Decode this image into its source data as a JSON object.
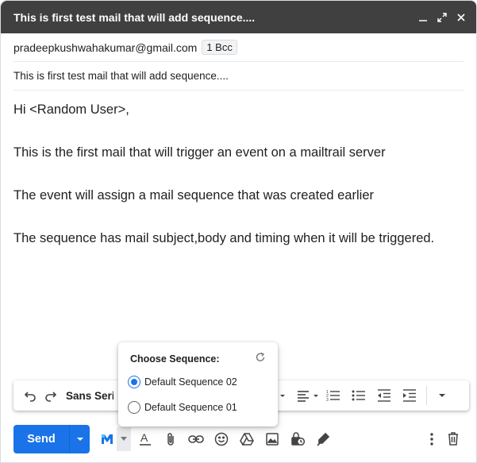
{
  "window": {
    "title": "This is first test mail that will add sequence...."
  },
  "recipients": {
    "to": "pradeepkushwahakumar@gmail.com",
    "bcc_label": "1 Bcc"
  },
  "subject": "This is first test mail that will add sequence....",
  "body": {
    "greeting": "Hi <Random User>,",
    "para1": "This is the first mail that will trigger an event on a mailtrail server",
    "para2": "The event will assign a mail sequence that was created earlier",
    "para3": "The sequence has mail subject,body and timing when it will be triggered."
  },
  "formatting": {
    "font": "Sans Serif"
  },
  "sequence_popup": {
    "title": "Choose Sequence:",
    "options": [
      {
        "label": "Default Sequence 02",
        "selected": true
      },
      {
        "label": "Default Sequence 01",
        "selected": false
      }
    ]
  },
  "bottom": {
    "send_label": "Send"
  },
  "colors": {
    "titlebar": "#404040",
    "accent": "#1a73e8"
  }
}
